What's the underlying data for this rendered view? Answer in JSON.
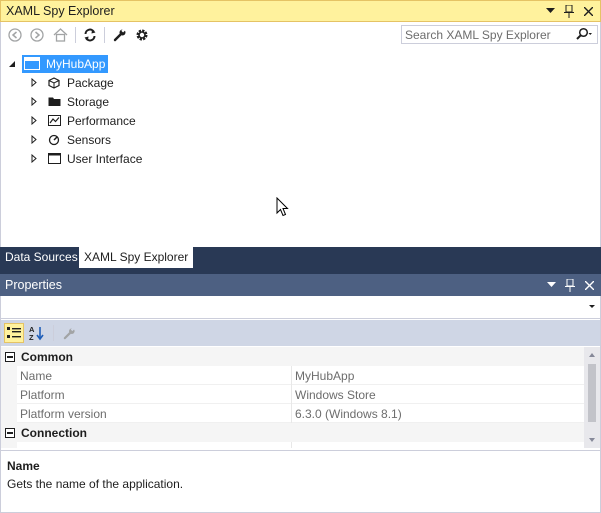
{
  "explorer": {
    "title": "XAML Spy Explorer",
    "search_placeholder": "Search XAML Spy Explorer",
    "tree": {
      "root_label": "MyHubApp",
      "children": [
        {
          "label": "Package",
          "icon": "package-icon"
        },
        {
          "label": "Storage",
          "icon": "folder-icon"
        },
        {
          "label": "Performance",
          "icon": "chart-icon"
        },
        {
          "label": "Sensors",
          "icon": "compass-icon"
        },
        {
          "label": "User Interface",
          "icon": "window-icon"
        }
      ]
    }
  },
  "tabs": [
    {
      "label": "Data Sources",
      "active": false
    },
    {
      "label": "XAML Spy Explorer",
      "active": true
    }
  ],
  "properties": {
    "title": "Properties",
    "categories": [
      {
        "name": "Common",
        "rows": [
          {
            "name": "Name",
            "value": "MyHubApp"
          },
          {
            "name": "Platform",
            "value": "Windows Store"
          },
          {
            "name": "Platform version",
            "value": "6.3.0 (Windows 8.1)"
          }
        ]
      },
      {
        "name": "Connection",
        "rows": []
      }
    ],
    "description": {
      "name": "Name",
      "text": "Gets the name of the application."
    }
  },
  "colors": {
    "active_title": "#fff29d",
    "tab_strip": "#293955",
    "inactive_title": "#4d6082",
    "selection": "#3399ff"
  }
}
